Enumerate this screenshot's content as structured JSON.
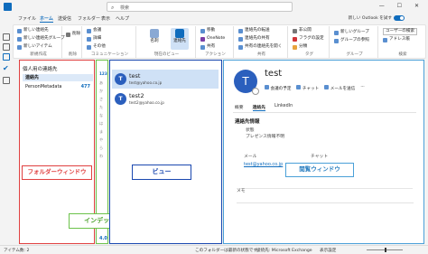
{
  "titlebar": {
    "search_placeholder": "検索",
    "window_buttons": "— ☐ ✕"
  },
  "menu": {
    "tabs": [
      "ファイル",
      "ホーム",
      "送受信",
      "フォルダー",
      "表示",
      "ヘルプ"
    ],
    "active_index": 1,
    "new_outlook": "新しい Outlook を試す"
  },
  "ribbon": {
    "groups": [
      {
        "label": "新規作成",
        "items": [
          "新しい連絡先",
          "新しい連絡先グループ",
          "新しいアイテム"
        ]
      },
      {
        "label": "削除",
        "items": [
          "削除"
        ]
      },
      {
        "label": "コミュニケーション",
        "items": [
          "会議",
          "詳細",
          "その他"
        ]
      },
      {
        "label": "現在のビュー",
        "items": [
          "名刺",
          "連絡先"
        ]
      },
      {
        "label": "アクション",
        "items": [
          "移動",
          "OneNote",
          "共有"
        ]
      },
      {
        "label": "共有",
        "items": [
          "連絡先の転送",
          "連絡先の共有",
          "共有の連絡先を開く"
        ]
      },
      {
        "label": "タグ",
        "items": [
          "非公開",
          "フラグの設定",
          "分類"
        ]
      },
      {
        "label": "グループ",
        "items": [
          "新しいグループ",
          "グループの参照"
        ]
      },
      {
        "label": "検索",
        "items": [
          "ユーザーの検索",
          "アドレス帳"
        ]
      }
    ]
  },
  "folder_pane": {
    "header": "個人用の連絡先",
    "items": [
      {
        "label": "連絡先",
        "count": ""
      },
      {
        "label": "PersonMetadata",
        "count": "477"
      }
    ],
    "callout": "フォルダーウィンドウ"
  },
  "index": {
    "top": "123",
    "letters": [
      "あ",
      "か",
      "さ",
      "た",
      "な",
      "は",
      "ま",
      "や",
      "ら",
      "わ"
    ],
    "bottom": "4.0",
    "callout": "インデックス"
  },
  "view": {
    "contacts": [
      {
        "initial": "T",
        "name": "test",
        "email": "test@yahoo.co.jp"
      },
      {
        "initial": "T",
        "name": "test2",
        "email": "test2@yahoo.co.jp"
      }
    ],
    "callout": "ビュー"
  },
  "reading": {
    "initial": "T",
    "name": "test",
    "actions": [
      "会議の予定",
      "チャット",
      "メールを送信"
    ],
    "tabs": [
      "概要",
      "連絡先",
      "LinkedIn"
    ],
    "section_title": "連絡先情報",
    "status_label": "状態",
    "status_value": "プレゼンス情報不明",
    "mail_label": "メール",
    "mail_value": "test@yahoo.co.jp",
    "chat_label": "チャット",
    "note_label": "メモ",
    "callout": "閲覧ウィンドウ"
  },
  "statusbar": {
    "left": "アイテム数: 2",
    "mid": "このフォルダーは最新の状態です。",
    "connect": "接続先: Microsoft Exchange",
    "display": "表示設定"
  }
}
